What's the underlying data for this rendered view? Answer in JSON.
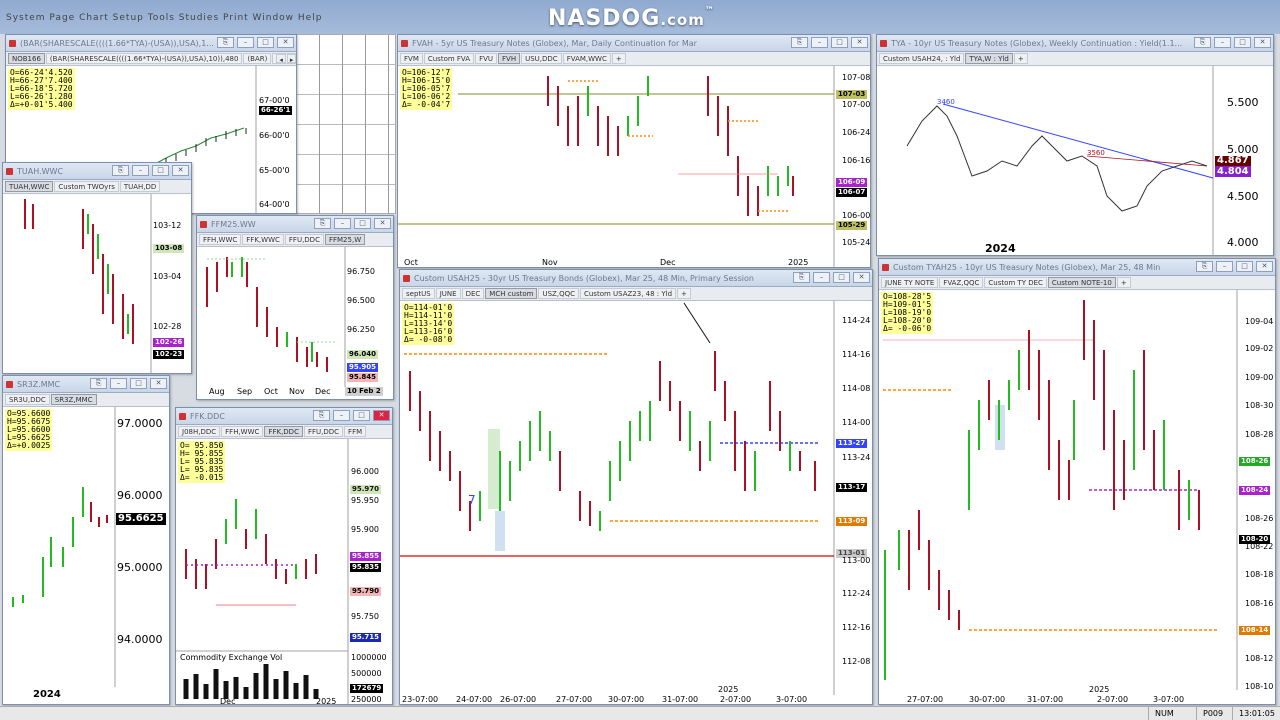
{
  "banner": {
    "menu": "System   Page   Chart Setup   Tools   Studies   Print   Window   Help",
    "brand": "NASDOG",
    "brand_suffix": ".com",
    "tm": "™"
  },
  "windows": {
    "w1": {
      "title": "(BAR(SHARESCALE((((1.66*TYA)-(USA)),USA),1...",
      "title2": "(BAR(SHARESCALE((((1.66*TYA)-(USA)),USA),10)),480   (BAR)",
      "ohlc": "O=66-24'4.520\nH=66-27'7.400\nL=66-18'5.720\nL=66-26'1.280\nΔ=+0-01'5.400",
      "tabs": [
        "NOB166",
        "(BAR(SHARESCALE((((1.66*TYA)-(USA)),USA),10)),480",
        "(BAR)"
      ],
      "yticks": [
        "67-00'0",
        "66-00'0",
        "65-00'0",
        "64-00'0"
      ],
      "plabel": "66-26'1"
    },
    "tuah": {
      "title": "TUAH.WWC",
      "tabs": [
        "TUAH,WWC",
        "Custom TWOyrs",
        "TUAH,DD"
      ],
      "yticks": [
        "103-12",
        "103-04",
        "102-28"
      ],
      "plabels": [
        "103-08",
        "102-26",
        "102-23"
      ]
    },
    "ffm": {
      "title": "FFM25.WW",
      "tabs": [
        "FFH,WWC",
        "FFK,WWC",
        "FFU,DDC",
        "FFM25,W"
      ],
      "yticks": [
        "96.750",
        "96.500",
        "96.250"
      ],
      "xticks": [
        "Aug",
        "Sep",
        "Oct",
        "Nov",
        "Dec"
      ],
      "plabels": [
        "96.040",
        "95.905",
        "95.845"
      ],
      "datebox": "10 Feb 2"
    },
    "sr3": {
      "title": "SR3Z.MMC",
      "tabs": [
        "SR3U,DDC",
        "SR3Z,MMC"
      ],
      "ohlc": "O=95.6600\nH=95.6675\nL=95.6600\nL=95.6625\nΔ=+0.0025",
      "yticks": [
        "97.0000",
        "96.0000",
        "95.0000",
        "94.0000"
      ],
      "plabel": "95.6625",
      "xtick": "2024"
    },
    "ffk": {
      "title": "FFK.DDC",
      "tabs": [
        "J08H,DDC",
        "FFH,WWC",
        "FFK,DDC",
        "FFU,DDC",
        "FFM"
      ],
      "ohlc": "O= 95.850\nH= 95.855\nL= 95.835\nL= 95.835\nΔ= -0.015",
      "yticks": [
        "96.000",
        "95.950",
        "95.900",
        "95.750"
      ],
      "plabels": [
        "95.970",
        "95.855",
        "95.835",
        "95.790",
        "95.715"
      ],
      "vol_label": "Commodity Exchange Vol",
      "vol_ticks": [
        "1000000",
        "500000",
        "250000"
      ],
      "vol_plabel": "172679",
      "xticks": [
        "Dec",
        "2025"
      ]
    },
    "fvah": {
      "title": "FVAH - 5yr US Treasury Notes (Globex), Mar, Daily Continuation for Mar",
      "tabs": [
        "FVM",
        "Custom FVA",
        "FVU",
        "FVH",
        "USU,DDC",
        "FVAM,WWC"
      ],
      "ohlc": "O=106-12'7\nH=106-15'0\nL=106-05'7\nL=106-06'2\nΔ= -0-04'7",
      "yticks": [
        "107-08",
        "107-00",
        "106-24",
        "106-16",
        "106-00",
        "105-24"
      ],
      "plabels": [
        "107-03",
        "106-09",
        "106-07",
        "105-29"
      ],
      "xticks": [
        "Oct",
        "Nov",
        "Dec",
        "2025"
      ]
    },
    "tya": {
      "title": "TYA - 10yr US Treasury Notes (Globex), Weekly Continuation : Yield(1.1...",
      "tabs": [
        "Custom USAH24, : Yld",
        "TYA,W : Yld"
      ],
      "yticks": [
        "5.500",
        "5.000",
        "4.500",
        "4.000"
      ],
      "plabels": [
        "4.867",
        "4.804"
      ],
      "annots": [
        "3460",
        "3560"
      ],
      "xtick": "2024"
    },
    "usah": {
      "title": "Custom USAH25 - 30yr US Treasury Bonds (Globex), Mar 25, 48 Min, Primary Session",
      "tabs": [
        "septUS",
        "JUNE",
        "DEC",
        "MCH custom",
        "USZ,QQC",
        "Custom USAZ23, 48 : Yld"
      ],
      "ohlc": "O=114-01'0\nH=114-11'0\nL=113-14'0\nL=113-16'0\nΔ= -0-08'0",
      "yticks": [
        "114-24",
        "114-16",
        "114-08",
        "114-00",
        "113-24",
        "113-00",
        "112-24",
        "112-16",
        "112-08"
      ],
      "plabels": [
        "113-27",
        "113-17",
        "113-09",
        "113-01"
      ],
      "xticks": [
        "23-07:00",
        "24-07:00",
        "26-07:00",
        "27-07:00",
        "30-07:00",
        "31-07:00",
        "2-07:00",
        "3-07:00"
      ],
      "xyear": "2025",
      "marker": "7"
    },
    "tyah": {
      "title": "Custom TYAH25 - 10yr US Treasury Notes (Globex), Mar 25, 48 Min",
      "tabs": [
        "JUNE TY NOTE",
        "FVAZ,QQC",
        "Custom TY DEC",
        "Custom NOTE-10"
      ],
      "ohlc": "O=108-28'5\nH=109-01'5\nL=108-19'0\nL=108-20'0\nΔ= -0-06'0",
      "yticks": [
        "109-04",
        "109-02",
        "109-00",
        "108-30",
        "108-28",
        "108-26",
        "108-22",
        "108-18",
        "108-16",
        "108-12",
        "108-10"
      ],
      "plabels": [
        "108-26",
        "108-24",
        "108-20",
        "108-14"
      ],
      "xticks": [
        "27-07:00",
        "30-07:00",
        "31-07:00",
        "2-07:00",
        "3-07:00"
      ],
      "xyear": "2025"
    }
  },
  "status": {
    "num": "NUM",
    "page": "P009",
    "time": "13:01:05"
  },
  "colors": {
    "up": "#22bb22",
    "down": "#aa1122",
    "orange": "#ff8800",
    "purple": "#aa22cc",
    "blue": "#3344ff",
    "red": "#e00000"
  }
}
